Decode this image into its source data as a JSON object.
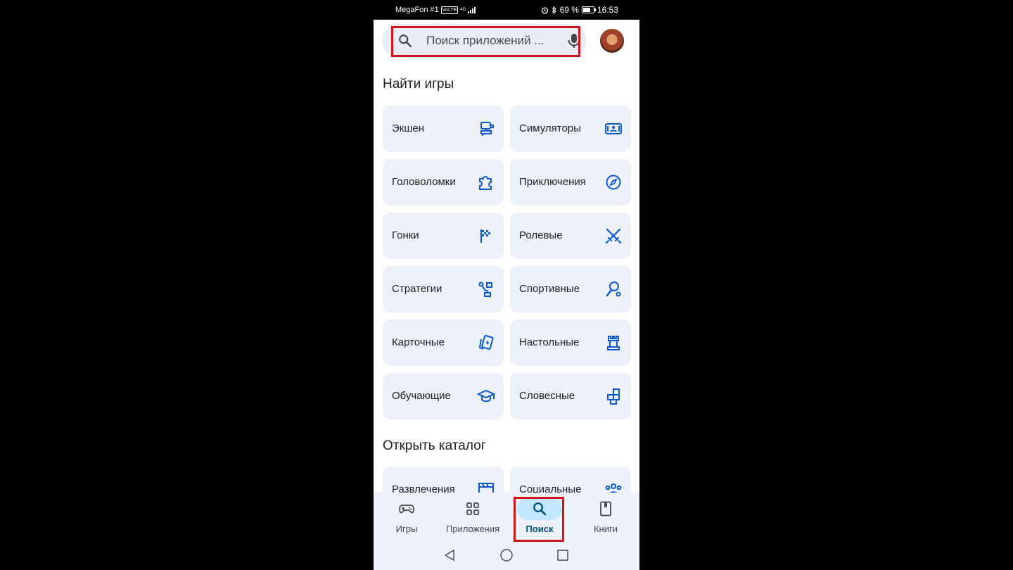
{
  "status_bar": {
    "carrier": "MegaFon #1",
    "volte": "VoLTE",
    "network": "4G",
    "battery": "69 %",
    "time": "16:53"
  },
  "search": {
    "placeholder": "Поиск приложений ...",
    "search_icon": "search-icon",
    "mic_icon": "mic-icon",
    "highlight_color": "#d1141c"
  },
  "avatar_icon": "avatar",
  "find_games": {
    "title": "Найти игры",
    "categories": [
      {
        "label": "Экшен",
        "icon": "action-icon"
      },
      {
        "label": "Симуляторы",
        "icon": "simulation-icon"
      },
      {
        "label": "Головоломки",
        "icon": "puzzle-icon"
      },
      {
        "label": "Приключения",
        "icon": "compass-icon"
      },
      {
        "label": "Гонки",
        "icon": "racing-flag-icon"
      },
      {
        "label": "Ролевые",
        "icon": "swords-icon"
      },
      {
        "label": "Стратегии",
        "icon": "strategy-icon"
      },
      {
        "label": "Спортивные",
        "icon": "sport-icon"
      },
      {
        "label": "Карточные",
        "icon": "cards-icon"
      },
      {
        "label": "Настольные",
        "icon": "chess-rook-icon"
      },
      {
        "label": "Обучающие",
        "icon": "graduation-cap-icon"
      },
      {
        "label": "Словесные",
        "icon": "word-blocks-icon"
      }
    ]
  },
  "catalog": {
    "title": "Открыть каталог",
    "categories": [
      {
        "label": "Развлечения",
        "icon": "clapperboard-icon"
      },
      {
        "label": "Социальные",
        "icon": "people-icon"
      }
    ]
  },
  "bottom_nav": {
    "items": [
      {
        "label": "Игры",
        "icon": "gamepad-icon"
      },
      {
        "label": "Приложения",
        "icon": "apps-grid-icon"
      },
      {
        "label": "Поиск",
        "icon": "search-icon",
        "active": true
      },
      {
        "label": "Книги",
        "icon": "book-icon"
      }
    ],
    "active_color": "#c2e7ff"
  },
  "system_nav": [
    "back-icon",
    "home-icon",
    "recents-icon"
  ]
}
